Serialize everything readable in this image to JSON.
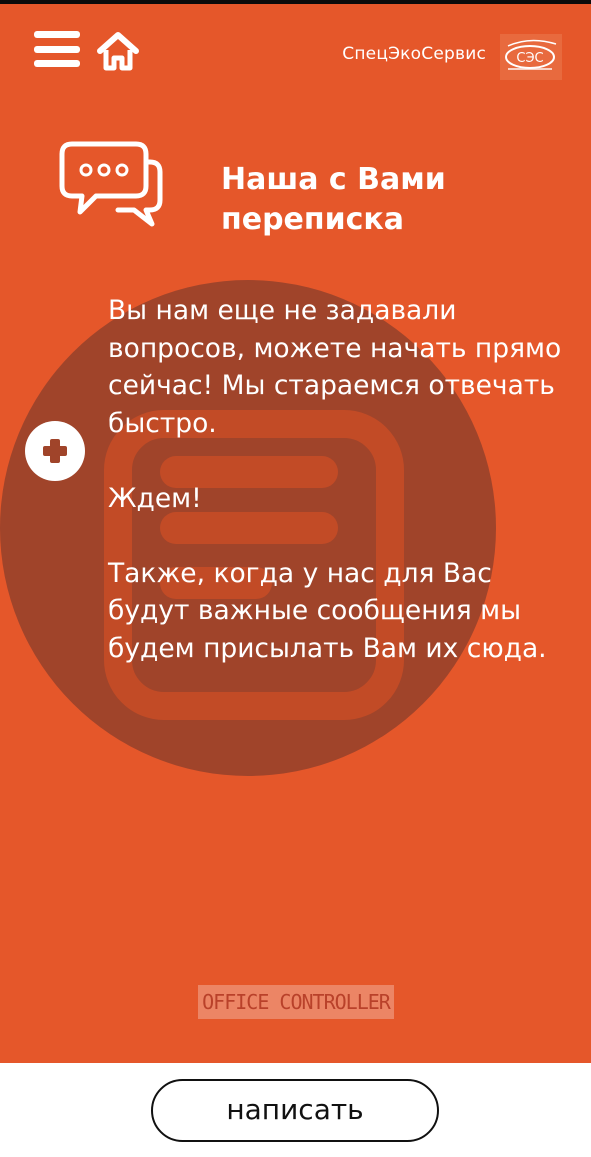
{
  "header": {
    "brand_name": "СпецЭкоСервис",
    "logo_text": "СЭС",
    "menu_icon": "hamburger-menu-icon",
    "home_icon": "home-icon"
  },
  "main": {
    "title_line1": "Наша с Вами",
    "title_line2": "переписка",
    "chat_icon": "chat-bubbles-icon",
    "paragraphs": [
      "Вы нам еще не задавали вопросов, можете начать прямо сейчас! Мы стараемся отвечать быстро.",
      "Ждем!",
      "Также, когда у нас для Вас будут важные сообщения мы будем присылать Вам их сюда."
    ],
    "add_icon": "plus-circle-icon"
  },
  "watermark": "OFFICE CONTROLLER",
  "footer": {
    "write_label": "написать"
  },
  "colors": {
    "accent": "#e5572a",
    "watermark_circle": "#a0442a",
    "text_on_accent": "#ffffff"
  }
}
